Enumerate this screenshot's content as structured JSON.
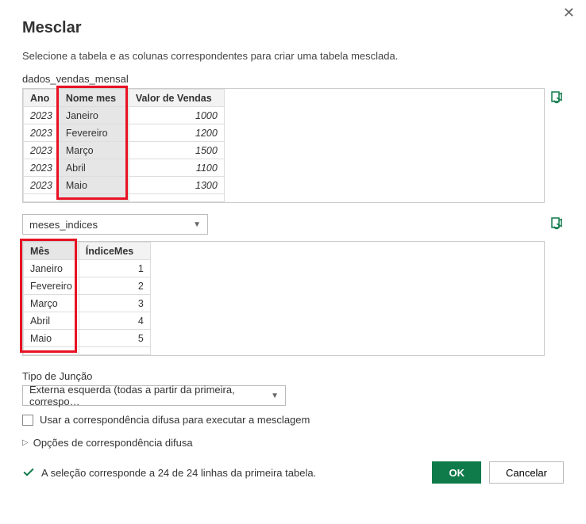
{
  "title": "Mesclar",
  "subtitle": "Selecione a tabela e as colunas correspondentes para criar uma tabela mesclada.",
  "close_label": "✕",
  "table1": {
    "name": "dados_vendas_mensal",
    "headers": {
      "ano": "Ano",
      "nome_mes": "Nome mes",
      "valor": "Valor de Vendas"
    },
    "rows": [
      {
        "ano": "2023",
        "nome_mes": "Janeiro",
        "valor": "1000"
      },
      {
        "ano": "2023",
        "nome_mes": "Fevereiro",
        "valor": "1200"
      },
      {
        "ano": "2023",
        "nome_mes": "Março",
        "valor": "1500"
      },
      {
        "ano": "2023",
        "nome_mes": "Abril",
        "valor": "1100"
      },
      {
        "ano": "2023",
        "nome_mes": "Maio",
        "valor": "1300"
      }
    ]
  },
  "table2": {
    "source_dropdown": "meses_indices",
    "headers": {
      "mes": "Mês",
      "indice": "ÍndiceMes"
    },
    "rows": [
      {
        "mes": "Janeiro",
        "indice": "1"
      },
      {
        "mes": "Fevereiro",
        "indice": "2"
      },
      {
        "mes": "Março",
        "indice": "3"
      },
      {
        "mes": "Abril",
        "indice": "4"
      },
      {
        "mes": "Maio",
        "indice": "5"
      }
    ]
  },
  "join": {
    "label": "Tipo de Junção",
    "selected": "Externa esquerda (todas a partir da primeira, correspo…"
  },
  "fuzzy": {
    "checkbox_label": "Usar a correspondência difusa para executar a mesclagem",
    "options_label": "Opções de correspondência difusa"
  },
  "status_text": "A seleção corresponde a 24 de 24 linhas da primeira tabela.",
  "buttons": {
    "ok": "OK",
    "cancel": "Cancelar"
  }
}
